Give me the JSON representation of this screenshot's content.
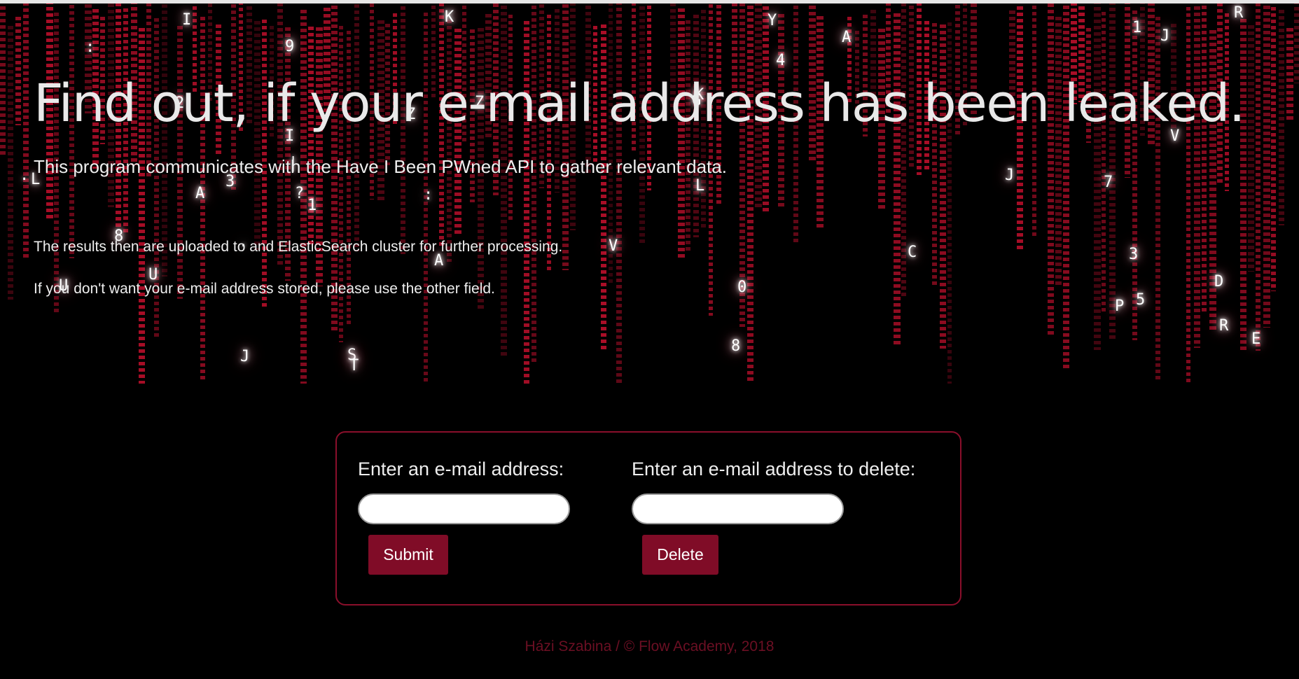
{
  "hero": {
    "title": "Find out, if your e-mail address has been leaked.",
    "subtitle": "This program communicates with the Have I Been PWned API to gather relevant data.",
    "paragraph_1": "The results then are uploaded to and ElasticSearch cluster for further processing.",
    "paragraph_2": "If you don't want your e-mail address stored, please use the other field."
  },
  "form": {
    "left": {
      "label": "Enter an e-mail address:",
      "value": "",
      "button": "Submit"
    },
    "right": {
      "label": "Enter an e-mail address to delete:",
      "value": "",
      "button": "Delete"
    }
  },
  "footer": {
    "text": "Házi Szabina / © Flow Academy, 2018"
  },
  "colors": {
    "background": "#000000",
    "accent": "#800c27",
    "card_border": "#8a0f2b",
    "footer_text": "#6b0f23",
    "rain": "#c8102e"
  }
}
